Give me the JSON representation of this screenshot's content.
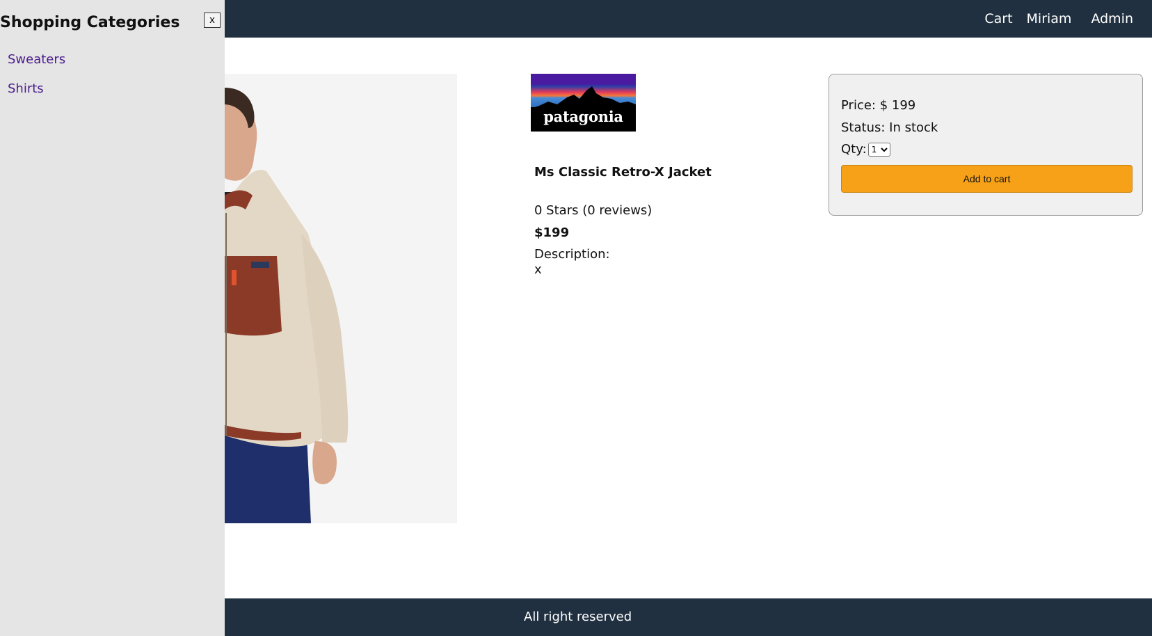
{
  "header": {
    "nav": {
      "cart": "Cart",
      "user": "Miriam",
      "admin": "Admin"
    }
  },
  "sidebar": {
    "title": "Shopping Categories",
    "close_label": "x",
    "items": [
      {
        "label": "Sweaters"
      },
      {
        "label": "Shirts"
      }
    ]
  },
  "product": {
    "brand_logo_text": "patagonia",
    "name": "Ms Classic Retro-X Jacket",
    "rating_text": "0 Stars (0 reviews)",
    "price_display": "$199",
    "description_label": "Description:",
    "description": "x"
  },
  "buy_box": {
    "price_text": "Price: $ 199",
    "status_text": "Status: In stock",
    "qty_label": "Qty:",
    "qty_selected": "1",
    "add_to_cart_label": "Add to cart"
  },
  "footer": {
    "text": "All right reserved"
  },
  "colors": {
    "header_bg": "#203040",
    "sidebar_bg": "#e5e5e5",
    "link": "#4b1d8c",
    "button": "#f6a118",
    "buybox_bg": "#f0f0f0"
  }
}
